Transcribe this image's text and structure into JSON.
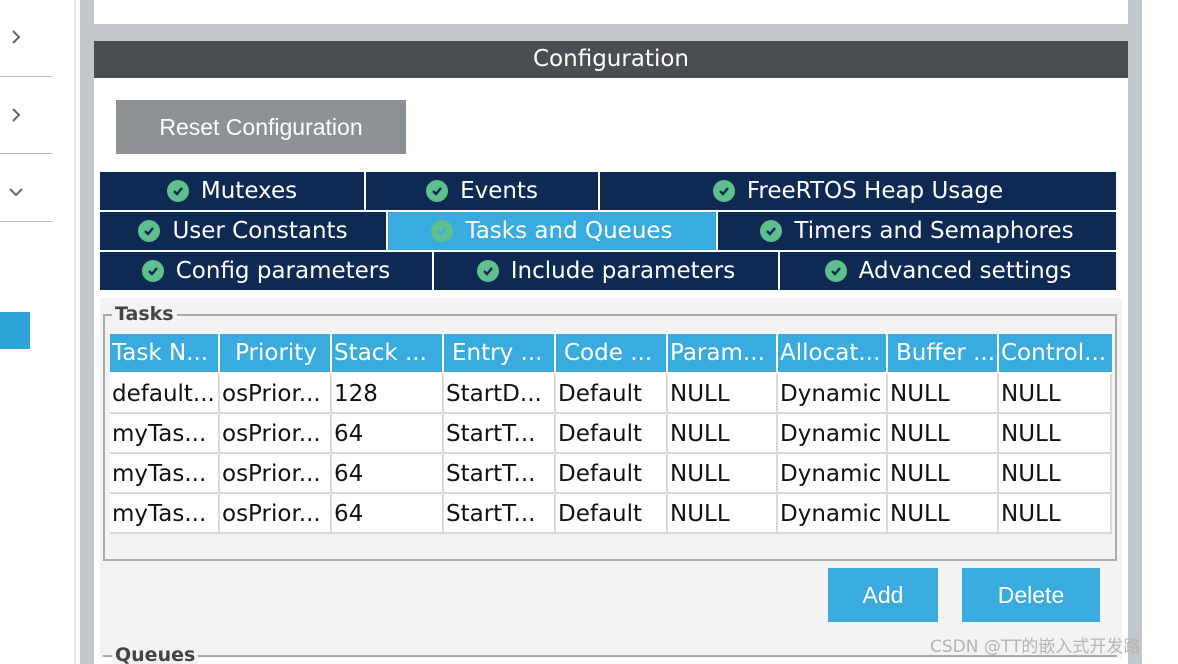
{
  "configuration": {
    "title": "Configuration",
    "reset_label": "Reset Configuration"
  },
  "tabs": {
    "row1": [
      "Mutexes",
      "Events",
      "FreeRTOS Heap Usage"
    ],
    "row2": [
      "User Constants",
      "Tasks and Queues",
      "Timers and Semaphores"
    ],
    "row3": [
      "Config parameters",
      "Include parameters",
      "Advanced settings"
    ],
    "active": "Tasks and Queues"
  },
  "tasks": {
    "group_label": "Tasks",
    "columns": [
      "Task N...",
      "Priority",
      "Stack ...",
      "Entry ...",
      "Code ...",
      "Param...",
      "Allocat...",
      "Buffer ...",
      "Control..."
    ],
    "rows": [
      [
        "default...",
        "osPrior...",
        "128",
        "StartD...",
        "Default",
        "NULL",
        "Dynamic",
        "NULL",
        "NULL"
      ],
      [
        "myTas...",
        "osPrior...",
        "64",
        "StartT...",
        "Default",
        "NULL",
        "Dynamic",
        "NULL",
        "NULL"
      ],
      [
        "myTas...",
        "osPrior...",
        "64",
        "StartT...",
        "Default",
        "NULL",
        "Dynamic",
        "NULL",
        "NULL"
      ],
      [
        "myTas...",
        "osPrior...",
        "64",
        "StartT...",
        "Default",
        "NULL",
        "Dynamic",
        "NULL",
        "NULL"
      ]
    ],
    "add_label": "Add",
    "delete_label": "Delete"
  },
  "queues": {
    "group_label": "Queues"
  },
  "watermark": "CSDN @TT的嵌入式开发路",
  "colors": {
    "accent": "#3aabdf",
    "tab_bg": "#0e2a53",
    "header_bg": "#4b4e51",
    "check": "#5fbf8e"
  },
  "icons": {
    "sidebar": [
      "chevron-right-icon",
      "chevron-right-icon",
      "chevron-down-icon"
    ],
    "tab_status": "check-circle-icon"
  }
}
